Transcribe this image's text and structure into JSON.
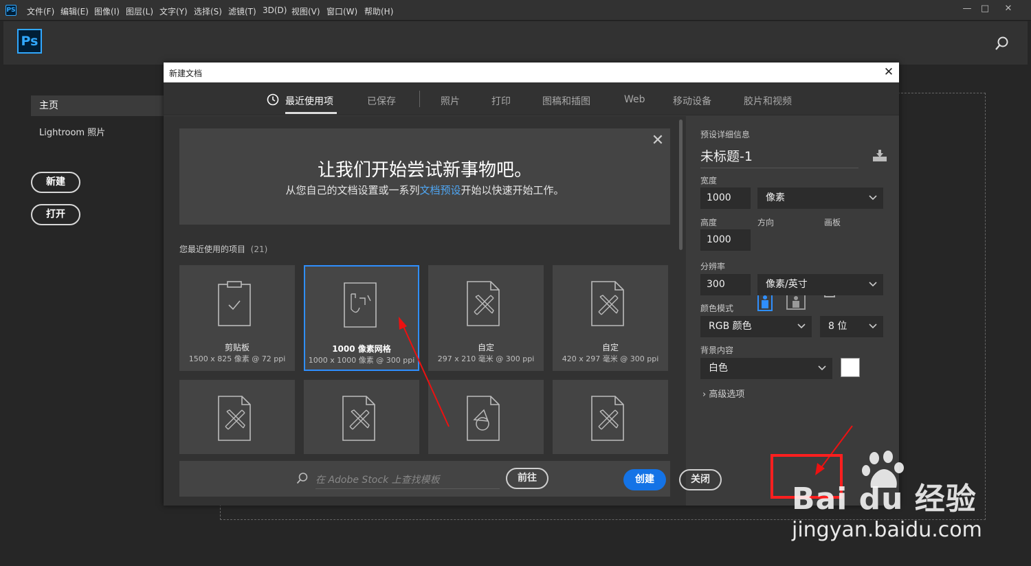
{
  "app": {
    "icon": "PS",
    "logo": "Ps"
  },
  "menu": [
    "文件(F)",
    "编辑(E)",
    "图像(I)",
    "图层(L)",
    "文字(Y)",
    "选择(S)",
    "滤镜(T)",
    "3D(D)",
    "视图(V)",
    "窗口(W)",
    "帮助(H)"
  ],
  "window_controls": {
    "minimize": "—",
    "maximize": "□",
    "close": "✕"
  },
  "home": {
    "nav_home": "主页",
    "nav_lightroom": "Lightroom 照片",
    "new_button": "新建",
    "open_button": "打开"
  },
  "dialog": {
    "title": "新建文档",
    "close": "✕",
    "tabs": [
      "最近使用项",
      "已保存",
      "照片",
      "打印",
      "图稿和插图",
      "Web",
      "移动设备",
      "胶片和视频"
    ],
    "welcome": {
      "close": "✕",
      "title": "让我们开始尝试新事物吧。",
      "subtitle_before": "从您自己的文档设置或一系列",
      "subtitle_link": "文档预设",
      "subtitle_after": "开始以快速开始工作。"
    },
    "recent_label": "您最近使用的项目",
    "recent_count": "(21)",
    "cards": [
      {
        "name": "剪贴板",
        "info": "1500 x 825 像素 @ 72 ppi",
        "icon": "clipboard-icon",
        "selected": false
      },
      {
        "name": "1000 像素网格",
        "info": "1000 x 1000 像素 @ 300 ppi",
        "icon": "grid-document-icon",
        "selected": true
      },
      {
        "name": "自定",
        "info": "297 x 210 毫米 @ 300 ppi",
        "icon": "custom-document-icon",
        "selected": false
      },
      {
        "name": "自定",
        "info": "420 x 297 毫米 @ 300 ppi",
        "icon": "custom-document-icon",
        "selected": false
      },
      {
        "name": "",
        "info": "",
        "icon": "custom-document-icon",
        "selected": false
      },
      {
        "name": "",
        "info": "",
        "icon": "custom-document-icon",
        "selected": false
      },
      {
        "name": "",
        "info": "",
        "icon": "shapes-document-icon",
        "selected": false
      },
      {
        "name": "",
        "info": "",
        "icon": "custom-document-icon",
        "selected": false
      }
    ],
    "stock_placeholder": "在 Adobe Stock 上查找模板",
    "goto_button": "前往",
    "preset": {
      "section_label": "预设详细信息",
      "doc_name": "未标题-1",
      "width_label": "宽度",
      "width_value": "1000",
      "width_unit": "像素",
      "height_label": "高度",
      "height_value": "1000",
      "orientation_label": "方向",
      "artboard_label": "画板",
      "resolution_label": "分辨率",
      "resolution_value": "300",
      "resolution_unit": "像素/英寸",
      "color_mode_label": "颜色模式",
      "color_mode": "RGB 颜色",
      "bit_depth": "8 位",
      "background_label": "背景内容",
      "background": "白色",
      "background_swatch": "#ffffff",
      "advanced": "高级选项"
    },
    "create_button": "创建",
    "close_button": "关闭"
  },
  "watermark": {
    "brand": "Bai du 经验",
    "url": "jingyan.baidu.com"
  },
  "colors": {
    "accent": "#1473e6",
    "selection": "#2f8fff",
    "annotation": "#ff1f1f",
    "link": "#4fa6f3"
  }
}
